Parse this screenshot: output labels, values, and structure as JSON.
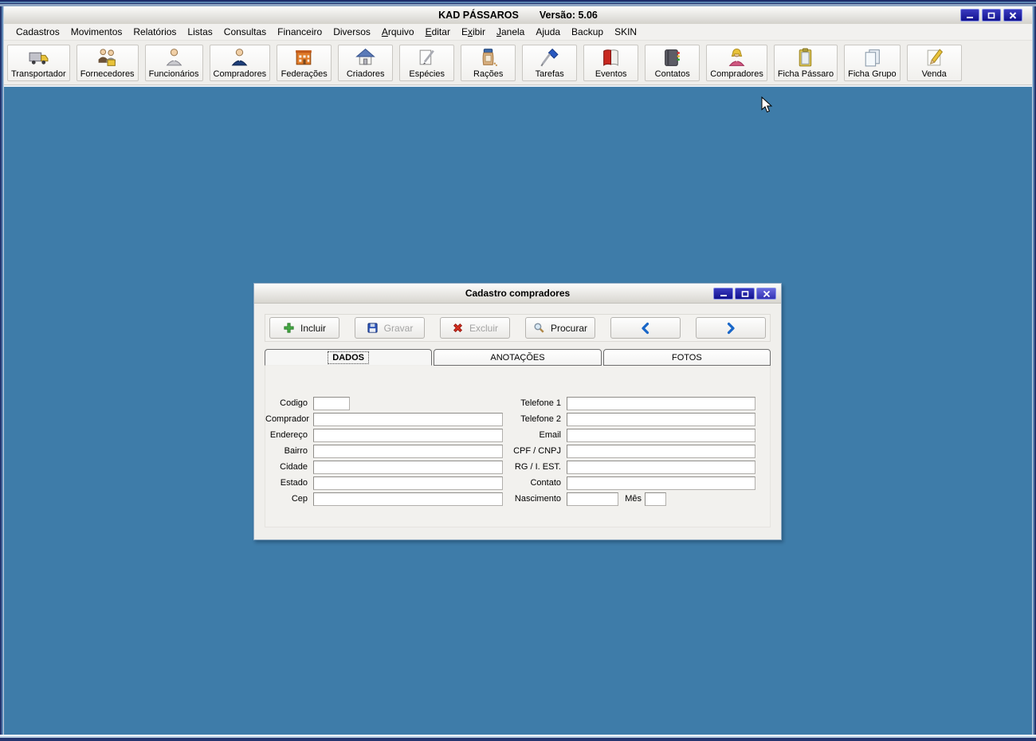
{
  "window": {
    "title": "KAD PÁSSAROS",
    "version_label": "Versão: 5.06"
  },
  "menubar": {
    "items": [
      {
        "label": "Cadastros",
        "u": -1
      },
      {
        "label": "Movimentos",
        "u": -1
      },
      {
        "label": "Relatórios",
        "u": -1
      },
      {
        "label": "Listas",
        "u": -1
      },
      {
        "label": "Consultas",
        "u": -1
      },
      {
        "label": "Financeiro",
        "u": -1
      },
      {
        "label": "Diversos",
        "u": -1
      },
      {
        "label": "Arquivo",
        "u": 0
      },
      {
        "label": "Editar",
        "u": 0
      },
      {
        "label": "Exibir",
        "u": 1
      },
      {
        "label": "Janela",
        "u": 0
      },
      {
        "label": "Ajuda",
        "u": -1
      },
      {
        "label": "Backup",
        "u": -1
      },
      {
        "label": "SKIN",
        "u": -1
      }
    ]
  },
  "toolbar": {
    "items": [
      {
        "label": "Transportador",
        "icon": "truck-icon"
      },
      {
        "label": "Fornecedores",
        "icon": "suppliers-icon"
      },
      {
        "label": "Funcionários",
        "icon": "employee-icon"
      },
      {
        "label": "Compradores",
        "icon": "buyer-icon"
      },
      {
        "label": "Federações",
        "icon": "building-icon"
      },
      {
        "label": "Criadores",
        "icon": "house-icon"
      },
      {
        "label": "Espécies",
        "icon": "paper-pencil-icon"
      },
      {
        "label": "Rações",
        "icon": "feed-jar-icon"
      },
      {
        "label": "Tarefas",
        "icon": "screwdriver-icon"
      },
      {
        "label": "Eventos",
        "icon": "red-book-icon"
      },
      {
        "label": "Contatos",
        "icon": "address-book-icon"
      },
      {
        "label": "Compradores",
        "icon": "woman-icon"
      },
      {
        "label": "Ficha Pássaro",
        "icon": "clipboard-icon"
      },
      {
        "label": "Ficha Grupo",
        "icon": "documents-icon"
      },
      {
        "label": "Venda",
        "icon": "pencil-sheet-icon"
      }
    ]
  },
  "dialog": {
    "title": "Cadastro compradores",
    "buttons": {
      "incluir": "Incluir",
      "gravar": "Gravar",
      "excluir": "Excluir",
      "procurar": "Procurar"
    },
    "tabs": [
      {
        "label": "DADOS"
      },
      {
        "label": "ANOTAÇÕES"
      },
      {
        "label": "FOTOS"
      }
    ],
    "form": {
      "left": [
        {
          "label": "Codigo",
          "value": ""
        },
        {
          "label": "Comprador",
          "value": ""
        },
        {
          "label": "Endereço",
          "value": ""
        },
        {
          "label": "Bairro",
          "value": ""
        },
        {
          "label": "Cidade",
          "value": ""
        },
        {
          "label": "Estado",
          "value": ""
        },
        {
          "label": "Cep",
          "value": ""
        }
      ],
      "right": [
        {
          "label": "Telefone 1",
          "value": ""
        },
        {
          "label": "Telefone 2",
          "value": ""
        },
        {
          "label": "Email",
          "value": ""
        },
        {
          "label": "CPF / CNPJ",
          "value": ""
        },
        {
          "label": "RG / I. EST.",
          "value": ""
        },
        {
          "label": "Contato",
          "value": ""
        },
        {
          "label": "Nascimento",
          "value": ""
        }
      ],
      "mes": {
        "label": "Mês",
        "value": ""
      }
    }
  }
}
